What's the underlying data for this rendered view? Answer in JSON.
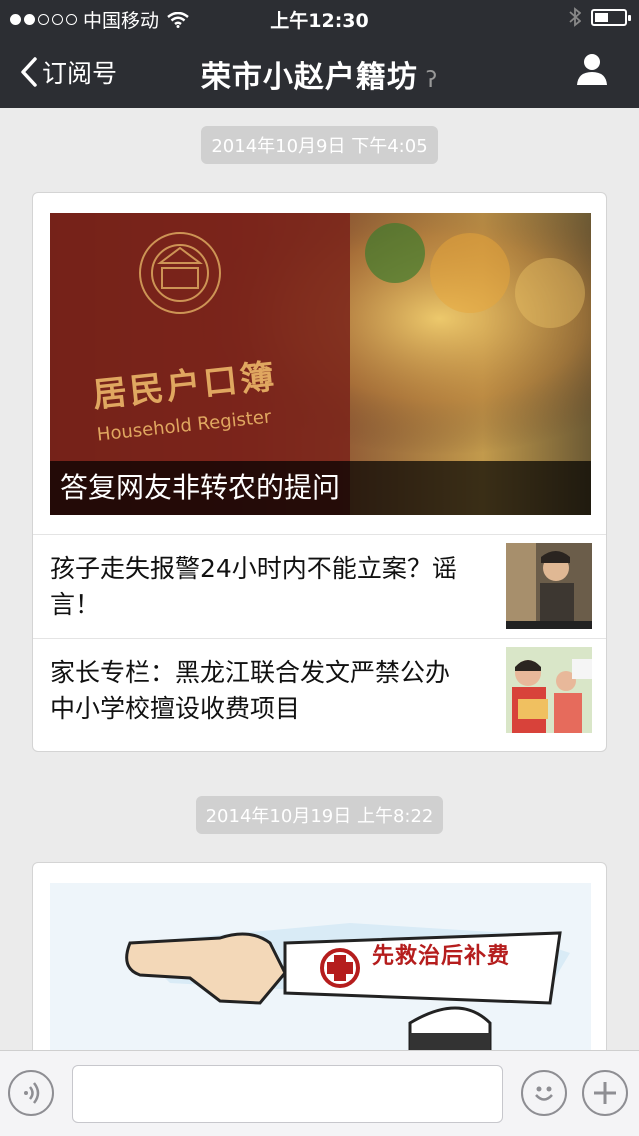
{
  "status_bar": {
    "carrier": "中国移动",
    "time": "上午12:30"
  },
  "nav": {
    "back_label": "订阅号",
    "title": "荣市小赵户籍坊"
  },
  "feed": [
    {
      "timestamp": "2014年10月9日 下午4:05",
      "cover_title": "答复网友非转农的提问",
      "cover_image_text": [
        "居民户口簿",
        "Household Register"
      ],
      "items": [
        {
          "title": "孩子走失报警24小时内不能立案？谣言！"
        },
        {
          "title": "家长专栏：黑龙江联合发文严禁公办中小学校擅设收费项目"
        }
      ]
    },
    {
      "timestamp": "2014年10月19日 上午8:22",
      "cover_image_text": "先救治后补费"
    }
  ],
  "input_bar": {
    "voice_icon": "voice-icon",
    "emoji_icon": "emoji-icon",
    "plus_icon": "plus-icon"
  },
  "colors": {
    "header_bg": "#2c2e33",
    "chat_bg": "#ebebeb",
    "timestamp_bg": "#d0d0d0"
  }
}
